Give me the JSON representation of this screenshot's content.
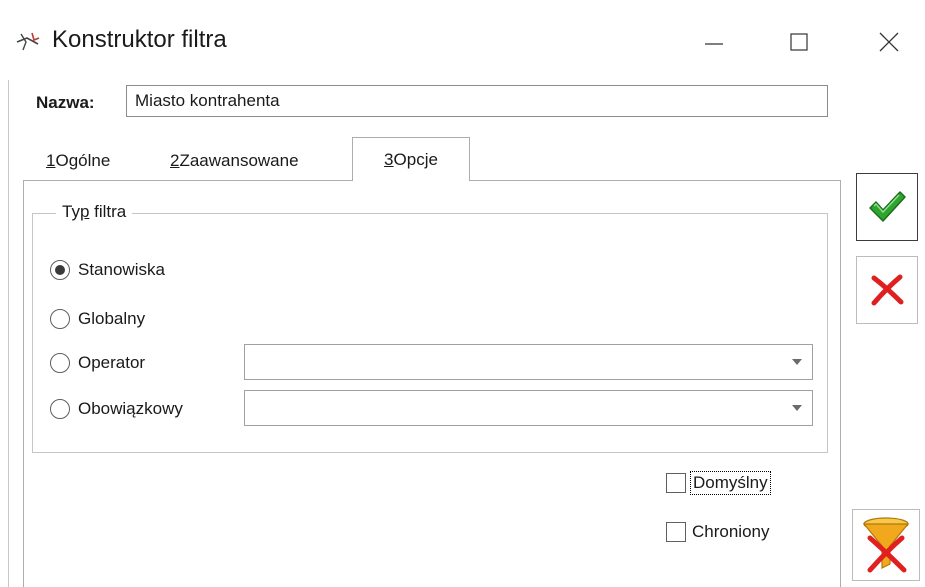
{
  "window": {
    "title": "Konstruktor filtra",
    "icons": {
      "app": "filter-constructor-icon",
      "minimize": "minimize-icon",
      "maximize": "maximize-icon",
      "close": "close-icon"
    }
  },
  "name_field": {
    "label": "Nazwa:",
    "value": "Miasto kontrahenta"
  },
  "tabs": [
    {
      "key": "1",
      "label": " Ogólne",
      "active": false
    },
    {
      "key": "2",
      "label": " Zaawansowane",
      "active": false
    },
    {
      "key": "3",
      "label": " Opcje",
      "active": true
    }
  ],
  "filter_type": {
    "legend_prefix": "Ty",
    "legend_accel": "p",
    "legend_suffix": " filtra",
    "options": [
      {
        "label": "Stanowiska",
        "checked": true
      },
      {
        "label": "Globalny",
        "checked": false
      },
      {
        "label": "Operator",
        "checked": false
      },
      {
        "label": "Obowiązkowy",
        "checked": false
      }
    ],
    "operator_combo_value": "",
    "mandatory_combo_value": ""
  },
  "checkboxes": {
    "default": {
      "label": "Domyślny",
      "checked": false
    },
    "protected": {
      "label": "Chroniony",
      "checked": false
    }
  },
  "actions": {
    "ok": "confirm-checkmark-icon",
    "cancel": "cancel-x-icon",
    "clear_filter": "clear-filter-icon"
  },
  "colors": {
    "ok_green": "#2fa52f",
    "cancel_red": "#e02020",
    "funnel_orange": "#f2a81c"
  }
}
